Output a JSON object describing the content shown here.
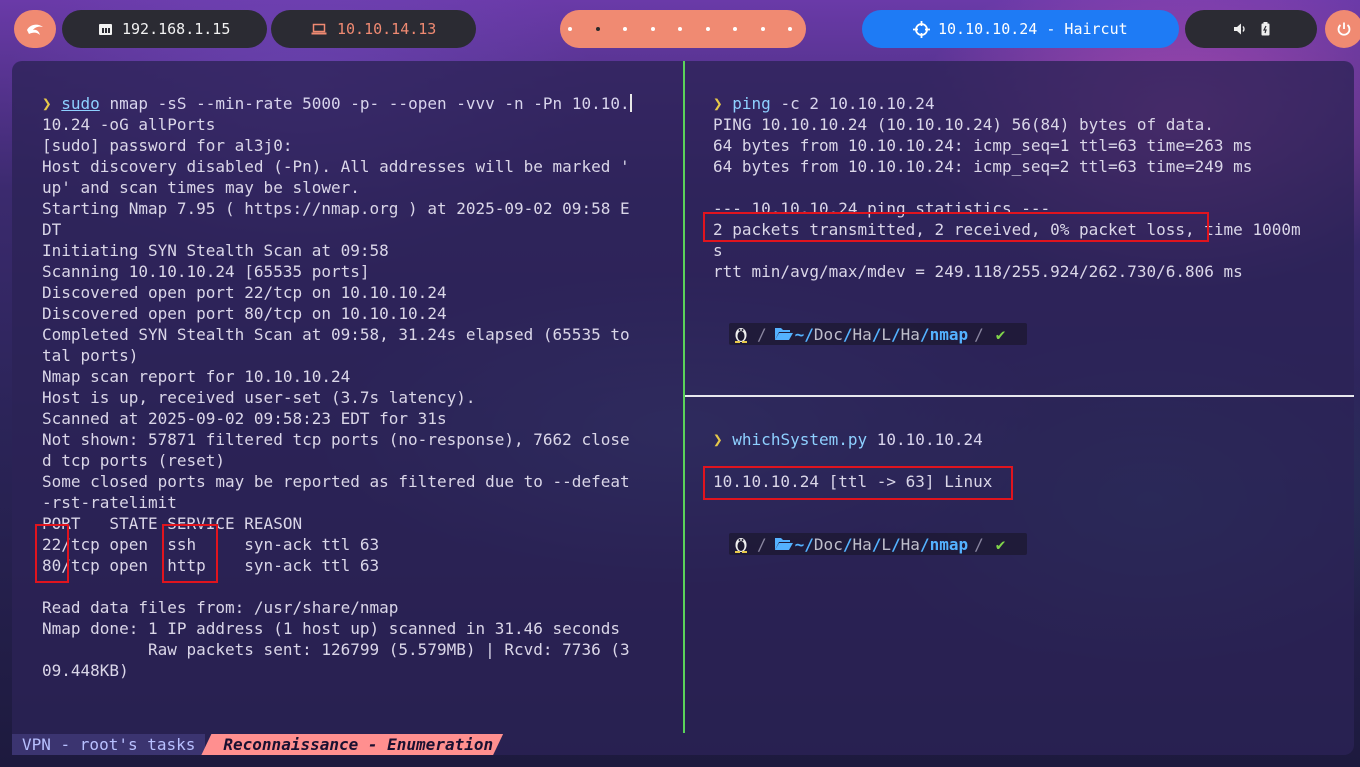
{
  "topbar": {
    "launcher_icon": "kali-dragon-icon",
    "local_ip": "192.168.1.15",
    "local_icon": "ethernet-icon",
    "vpn_ip": "10.10.14.13",
    "vpn_icon": "laptop-icon",
    "workspaces_count": 9,
    "active_workspace": 2,
    "target_label": "10.10.10.24 - Haircut",
    "target_icon": "crosshair-icon",
    "status_icons": [
      "volume-icon",
      "battery-icon"
    ],
    "power_icon": "power-icon",
    "colors": {
      "accent": "#f08a72",
      "target": "#1e7bf5",
      "dark_pill": "#2b2b33"
    }
  },
  "left_pane": {
    "prompt_symbol": "❯",
    "command_sudo": "sudo",
    "command_rest": " nmap -sS --min-rate 5000 -p- --open -vvv -n -Pn 10.10.",
    "command_cont": "10.24 -oG allPorts",
    "output": "[sudo] password for al3j0:\nHost discovery disabled (-Pn). All addresses will be marked '\nup' and scan times may be slower.\nStarting Nmap 7.95 ( https://nmap.org ) at 2025-09-02 09:58 E\nDT\nInitiating SYN Stealth Scan at 09:58\nScanning 10.10.10.24 [65535 ports]\nDiscovered open port 22/tcp on 10.10.10.24\nDiscovered open port 80/tcp on 10.10.10.24\nCompleted SYN Stealth Scan at 09:58, 31.24s elapsed (65535 to\ntal ports)\nNmap scan report for 10.10.10.24\nHost is up, received user-set (3.7s latency).\nScanned at 2025-09-02 09:58:23 EDT for 31s\nNot shown: 57871 filtered tcp ports (no-response), 7662 close\nd tcp ports (reset)\nSome closed ports may be reported as filtered due to --defeat\n-rst-ratelimit\nPORT   STATE SERVICE REASON\n22/tcp open  ssh     syn-ack ttl 63\n80/tcp open  http    syn-ack ttl 63\n\nRead data files from: /usr/share/nmap\nNmap done: 1 IP address (1 host up) scanned in 31.46 seconds\n           Raw packets sent: 126799 (5.579MB) | Rcvd: 7736 (3\n09.448KB)"
  },
  "top_right_pane": {
    "prompt_symbol": "❯",
    "command_main": "ping",
    "command_rest": " -c 2 10.10.10.24",
    "output": "PING 10.10.10.24 (10.10.10.24) 56(84) bytes of data.\n64 bytes from 10.10.10.24: icmp_seq=1 ttl=63 time=263 ms\n64 bytes from 10.10.10.24: icmp_seq=2 ttl=63 time=249 ms\n\n--- 10.10.10.24 ping statistics ---\n2 packets transmitted, 2 received, 0% packet loss, time 1000m\ns\nrtt min/avg/max/mdev = 249.118/255.924/262.730/6.806 ms",
    "path_prompt": {
      "tilde": "~",
      "parts": [
        "Doc",
        "Ha",
        "L",
        "Ha"
      ],
      "current": "nmap"
    }
  },
  "bottom_right_pane": {
    "prompt_symbol": "❯",
    "command_main": "whichSystem.py",
    "command_rest": " 10.10.10.24",
    "output": "10.10.10.24 [ttl -> 63] Linux",
    "path_prompt": {
      "tilde": "~",
      "parts": [
        "Doc",
        "Ha",
        "L",
        "Ha"
      ],
      "current": "nmap"
    }
  },
  "tmux": {
    "session_label": "VPN - root's tasks",
    "window_label": "Reconnaissance - Enumeration"
  }
}
